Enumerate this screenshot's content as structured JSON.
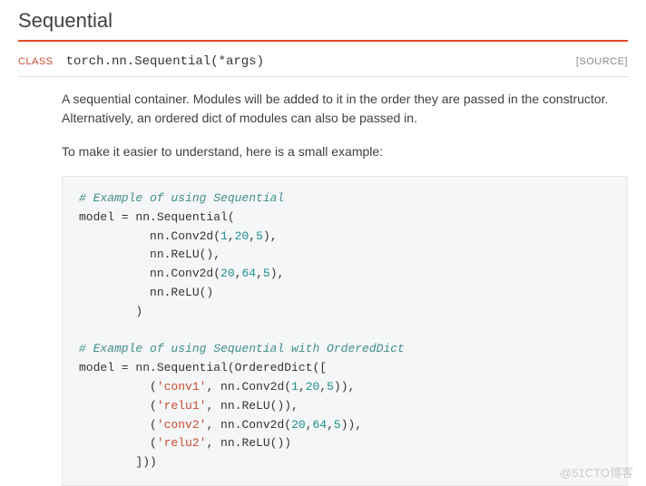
{
  "title": "Sequential",
  "class_label": "CLASS",
  "class_signature": "torch.nn.Sequential(*args)",
  "source_label": "[SOURCE]",
  "description1": "A sequential container. Modules will be added to it in the order they are passed in the constructor. Alternatively, an ordered dict of modules can also be passed in.",
  "description2": "To make it easier to understand, here is a small example:",
  "code": {
    "comment1": "# Example of using Sequential",
    "line1a": "model = nn.Sequential(",
    "line1b_pre": "          nn.Conv2d(",
    "line1b_n1": "1",
    "line1b_c1": ",",
    "line1b_n2": "20",
    "line1b_c2": ",",
    "line1b_n3": "5",
    "line1b_post": "),",
    "line1c": "          nn.ReLU(),",
    "line1d_pre": "          nn.Conv2d(",
    "line1d_n1": "20",
    "line1d_c1": ",",
    "line1d_n2": "64",
    "line1d_c2": ",",
    "line1d_n3": "5",
    "line1d_post": "),",
    "line1e": "          nn.ReLU()",
    "line1f": "        )",
    "comment2": "# Example of using Sequential with OrderedDict",
    "line2a": "model = nn.Sequential(OrderedDict([",
    "line2b_pre": "          (",
    "line2b_str": "'conv1'",
    "line2b_mid": ", nn.Conv2d(",
    "line2b_n1": "1",
    "line2b_c1": ",",
    "line2b_n2": "20",
    "line2b_c2": ",",
    "line2b_n3": "5",
    "line2b_post": ")),",
    "line2c_pre": "          (",
    "line2c_str": "'relu1'",
    "line2c_post": ", nn.ReLU()),",
    "line2d_pre": "          (",
    "line2d_str": "'conv2'",
    "line2d_mid": ", nn.Conv2d(",
    "line2d_n1": "20",
    "line2d_c1": ",",
    "line2d_n2": "64",
    "line2d_c2": ",",
    "line2d_n3": "5",
    "line2d_post": ")),",
    "line2e_pre": "          (",
    "line2e_str": "'relu2'",
    "line2e_post": ", nn.ReLU())",
    "line2f": "        ]))"
  },
  "watermark": "@51CTO博客"
}
